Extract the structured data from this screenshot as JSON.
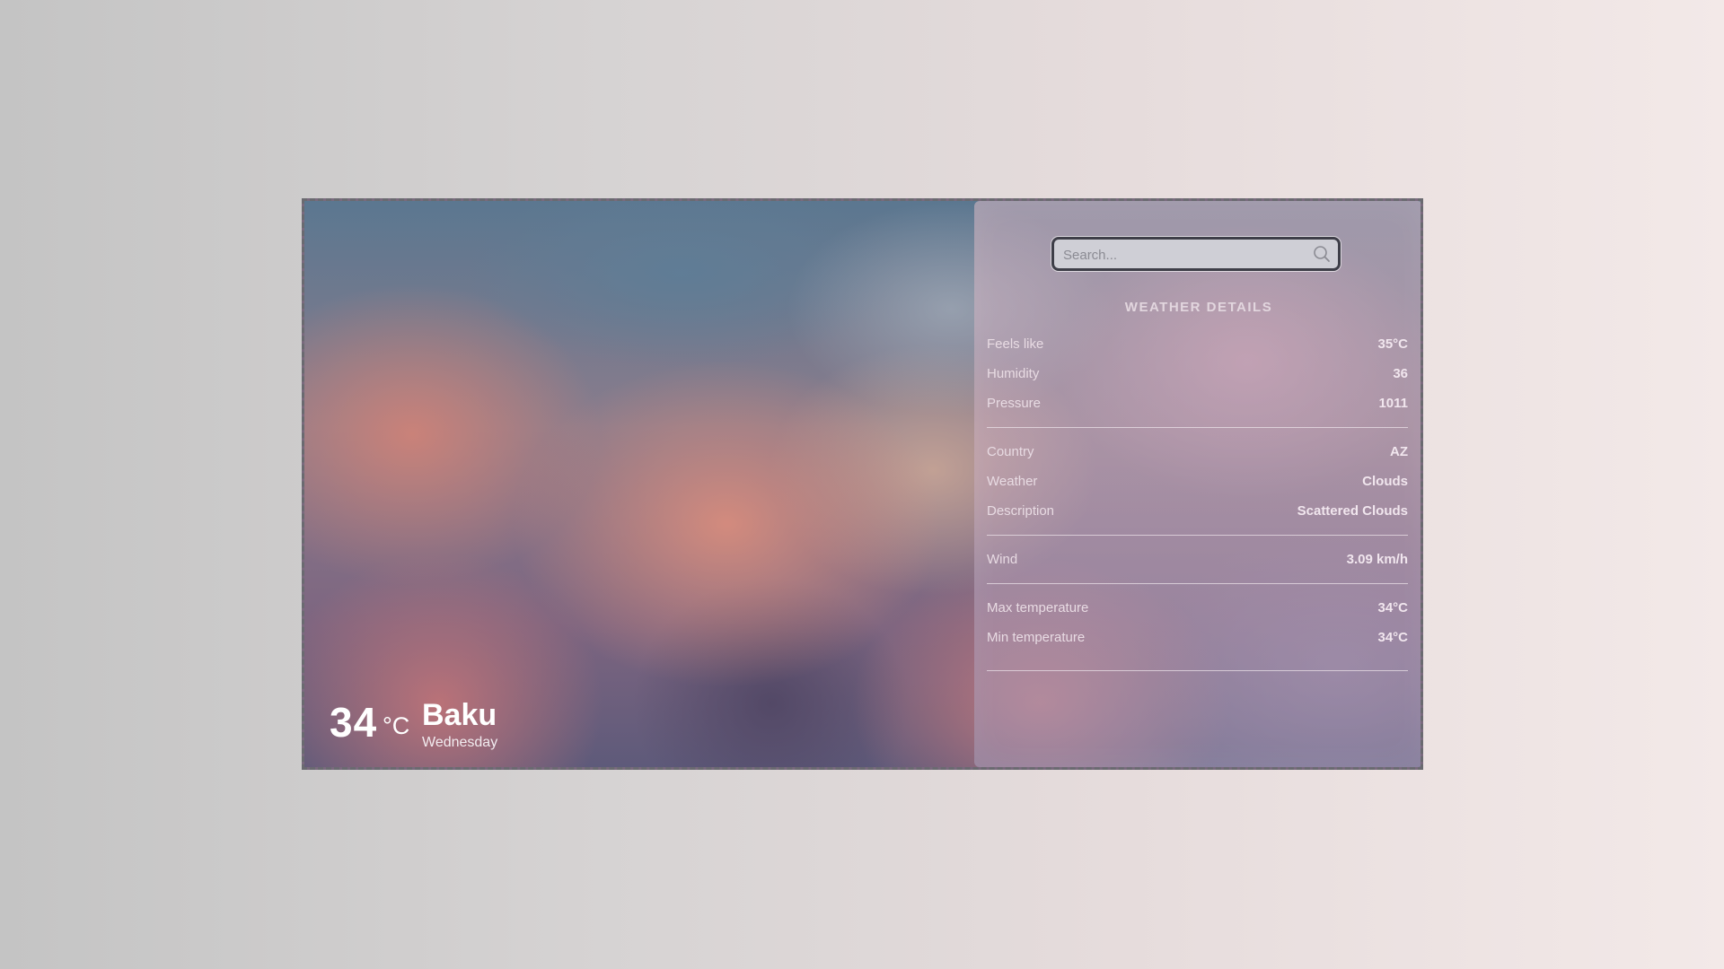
{
  "search": {
    "placeholder": "Search..."
  },
  "current": {
    "temperature": "34",
    "unit": "°C",
    "city": "Baku",
    "day": "Wednesday"
  },
  "details": {
    "title": "WEATHER DETAILS",
    "group1": [
      {
        "label": "Feels like",
        "value": "35°C"
      },
      {
        "label": "Humidity",
        "value": "36"
      },
      {
        "label": "Pressure",
        "value": "1011"
      }
    ],
    "group2": [
      {
        "label": "Country",
        "value": "AZ"
      },
      {
        "label": "Weather",
        "value": "Clouds"
      },
      {
        "label": "Description",
        "value": "Scattered Clouds"
      }
    ],
    "group3": [
      {
        "label": "Wind",
        "value": "3.09 km/h"
      }
    ],
    "group4": [
      {
        "label": "Max temperature",
        "value": "34°C"
      },
      {
        "label": "Min temperature",
        "value": "34°C"
      }
    ]
  },
  "colors": {
    "text": "#ffffff",
    "search_border": "#3e3e48",
    "card_border": "#6a6a70"
  },
  "icons": {
    "search": "search-icon"
  }
}
